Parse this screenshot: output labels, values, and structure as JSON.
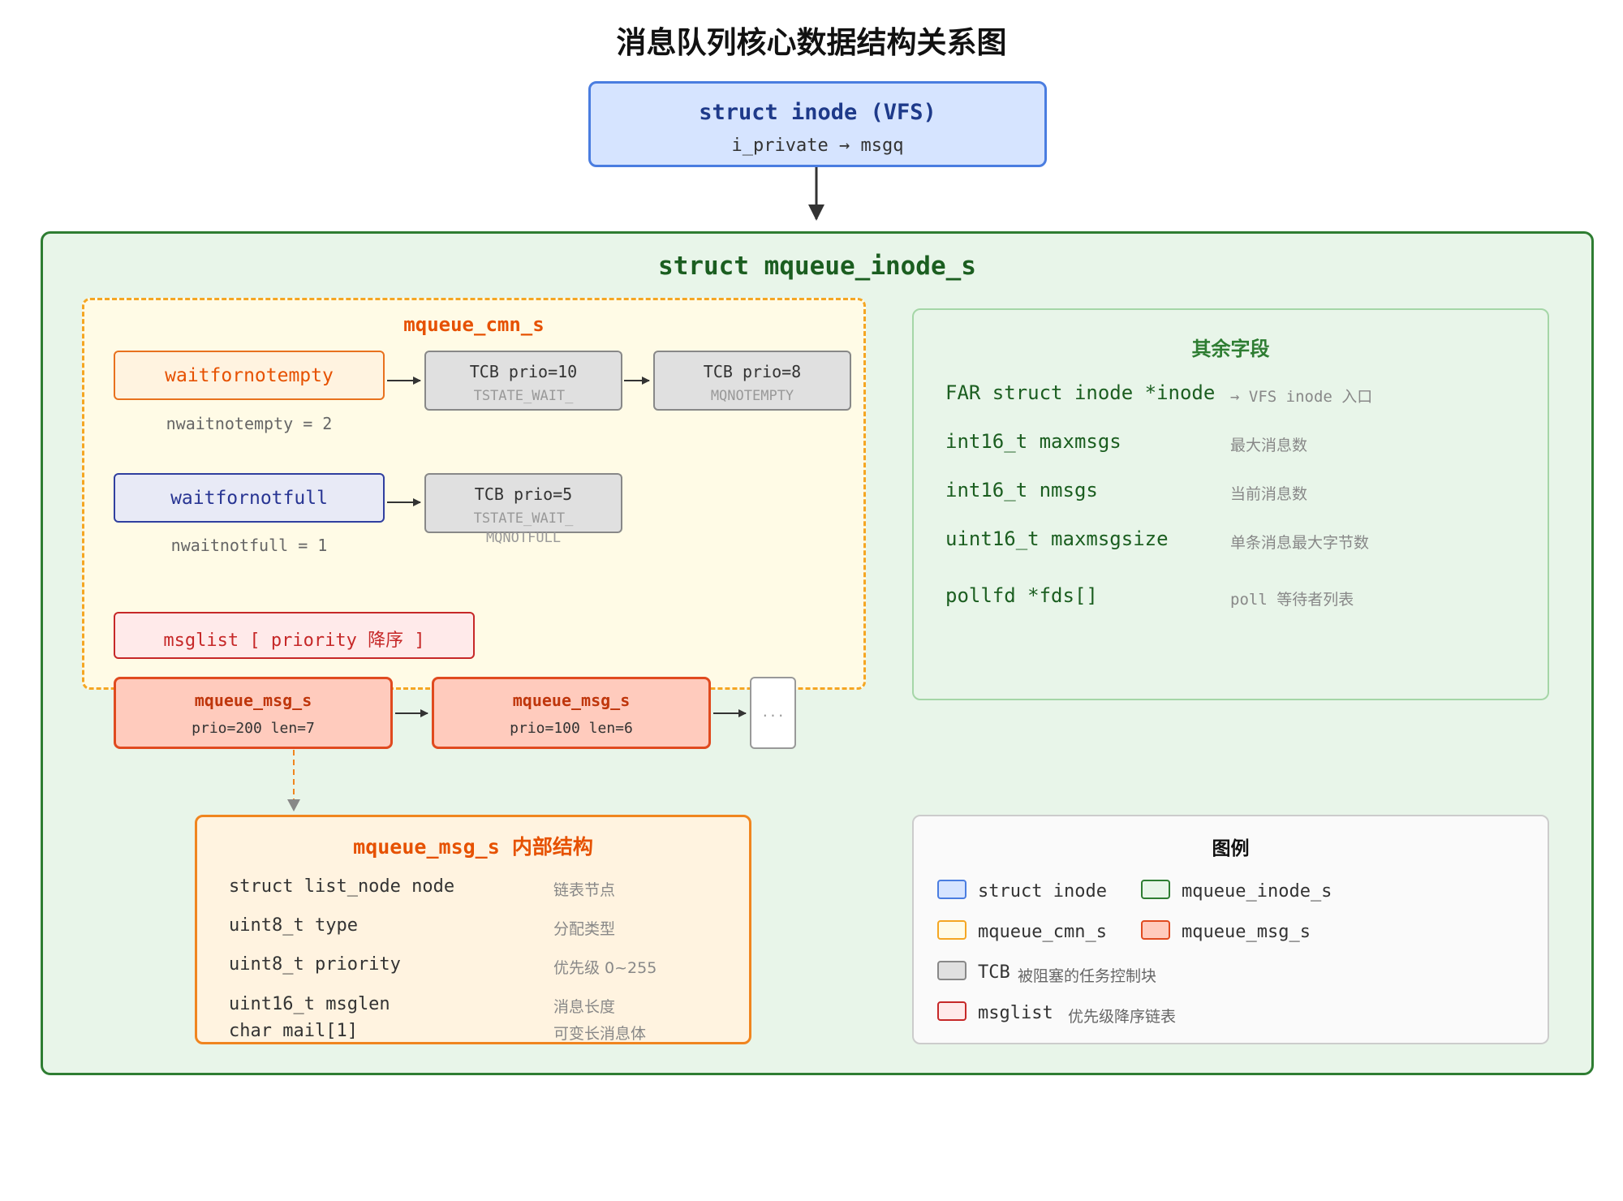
{
  "title": "消息队列核心数据结构关系图",
  "inode": {
    "name": "struct inode (VFS)",
    "field": "i_private → msgq"
  },
  "mqueue_inode": {
    "name": "struct mqueue_inode_s"
  },
  "cmn": {
    "name": "mqueue_cmn_s",
    "notempty": {
      "label": "waitfornotempty",
      "count": "nwaitnotempty = 2",
      "tcbs": [
        {
          "line1": "TCB prio=10",
          "line2": "TSTATE_WAIT_"
        },
        {
          "line1": "TCB prio=8",
          "line2": "MQNOTEMPTY"
        }
      ]
    },
    "notfull": {
      "label": "waitfornotfull",
      "count": "nwaitnotfull = 1",
      "tcbs": [
        {
          "line1": "TCB prio=5",
          "line2": "TSTATE_WAIT_",
          "line3": "MQNOTFULL"
        }
      ]
    },
    "msglist": "msglist [ priority 降序 ]"
  },
  "msgs": [
    {
      "name": "mqueue_msg_s",
      "info": "prio=200 len=7"
    },
    {
      "name": "mqueue_msg_s",
      "info": "prio=100 len=6"
    }
  ],
  "ellipsis": "...",
  "other": {
    "title": "其余字段",
    "fields": [
      {
        "code": "FAR struct inode *inode",
        "desc": "→ VFS inode 入口"
      },
      {
        "code": "int16_t maxmsgs",
        "desc": "最大消息数"
      },
      {
        "code": "int16_t nmsgs",
        "desc": "当前消息数"
      },
      {
        "code": "uint16_t maxmsgsize",
        "desc": "单条消息最大字节数"
      },
      {
        "code": "pollfd *fds[]",
        "desc": "poll 等待者列表"
      }
    ]
  },
  "internal": {
    "title": "mqueue_msg_s 内部结构",
    "fields": [
      {
        "code": "struct list_node node",
        "desc": "链表节点"
      },
      {
        "code": "uint8_t type",
        "desc": "分配类型"
      },
      {
        "code": "uint8_t priority",
        "desc": "优先级 0~255"
      },
      {
        "code": "uint16_t msglen",
        "desc": "消息长度"
      },
      {
        "code": "char mail[1]",
        "desc": "可变长消息体"
      }
    ]
  },
  "legend": {
    "title": "图例",
    "items": [
      {
        "label": "struct inode",
        "color": "#d6e4ff",
        "border": "#4a7de0"
      },
      {
        "label": "mqueue_inode_s",
        "color": "#e8f5e9",
        "border": "#2e7d32"
      },
      {
        "label": "mqueue_cmn_s",
        "color": "#fffbe6",
        "border": "#f5a623"
      },
      {
        "label": "mqueue_msg_s",
        "color": "#ffcbbd",
        "border": "#e04a1f"
      },
      {
        "label": "TCB",
        "desc": "被阻塞的任务控制块",
        "color": "#e0e0e0",
        "border": "#888888"
      },
      {
        "label": "msglist",
        "desc": "优先级降序链表",
        "color": "#ffeaea",
        "border": "#c62828"
      }
    ]
  }
}
